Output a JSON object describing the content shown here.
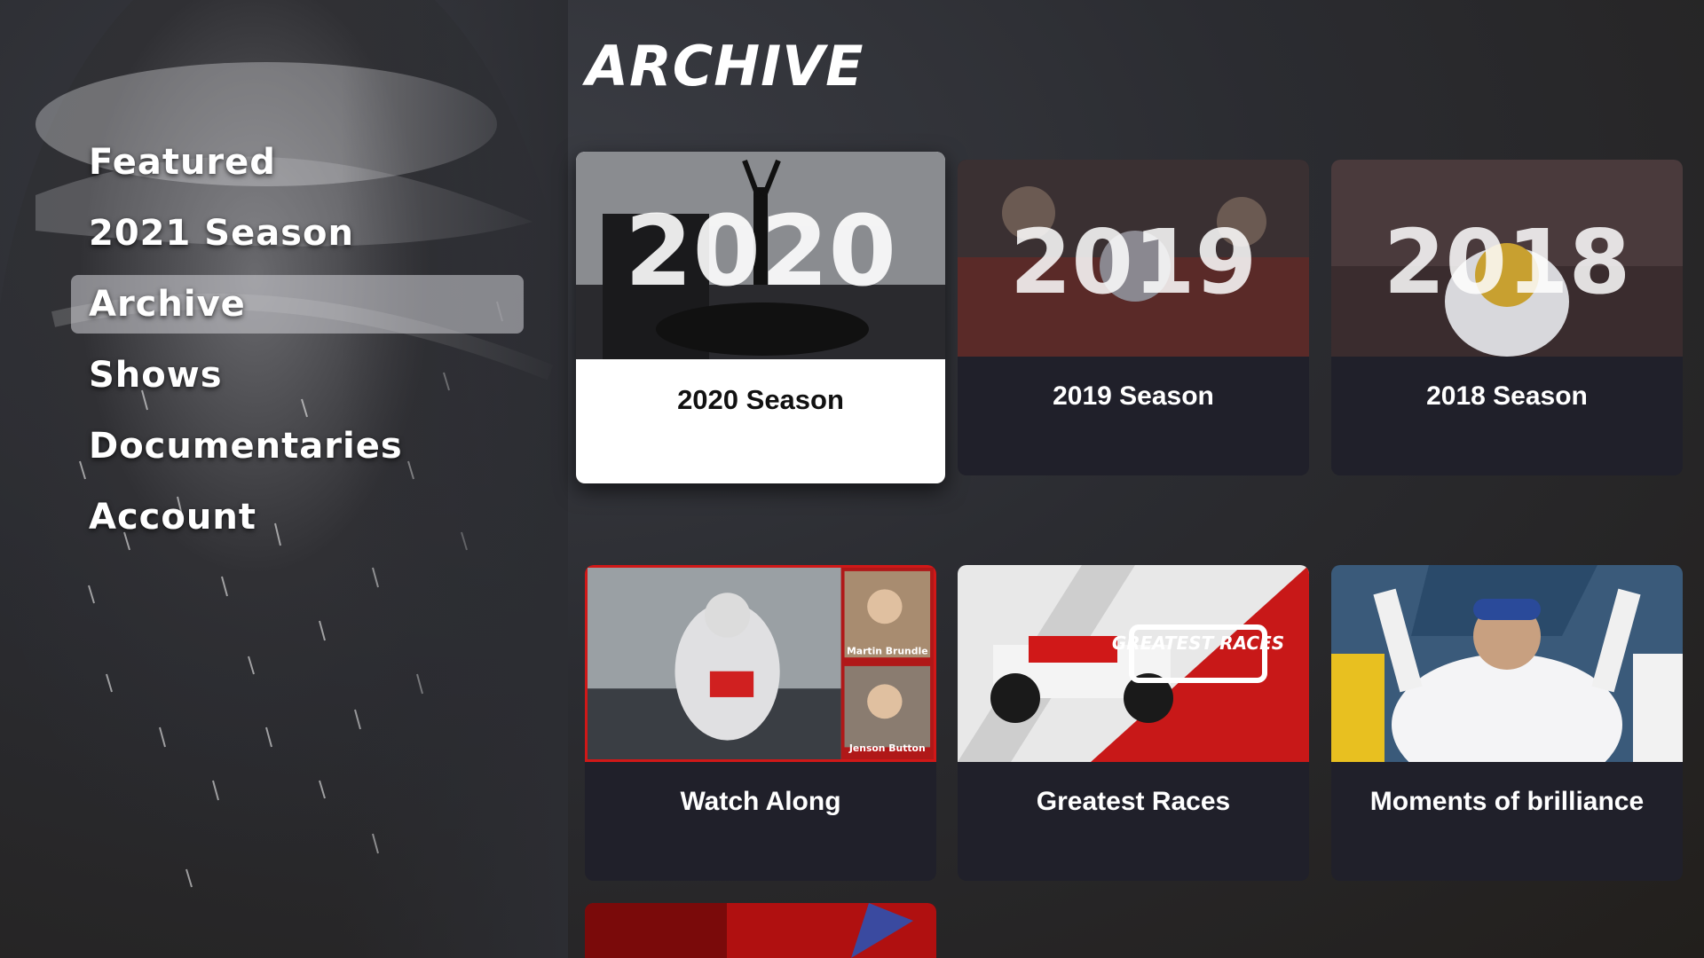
{
  "nav": {
    "items": [
      {
        "label": "Featured",
        "active": false
      },
      {
        "label": "2021 Season",
        "active": false
      },
      {
        "label": "Archive",
        "active": true
      },
      {
        "label": "Shows",
        "active": false
      },
      {
        "label": "Documentaries",
        "active": false
      },
      {
        "label": "Account",
        "active": false
      }
    ]
  },
  "page": {
    "title": "ARCHIVE"
  },
  "cards": [
    {
      "label": "2020 Season",
      "thumb_text": "2020",
      "focused": true
    },
    {
      "label": "2019 Season",
      "thumb_text": "2019",
      "focused": false
    },
    {
      "label": "2018 Season",
      "thumb_text": "2018",
      "focused": false
    },
    {
      "label": "Watch Along",
      "thumb_names": [
        "Martin Brundle",
        "Jenson Button"
      ],
      "focused": false
    },
    {
      "label": "Greatest Races",
      "thumb_text": "GREATEST RACES",
      "focused": false
    },
    {
      "label": "Moments of brilliance",
      "focused": false
    }
  ],
  "colors": {
    "accent_red": "#d01818",
    "card_bg": "#20202a",
    "focus_bg": "#ffffff"
  }
}
